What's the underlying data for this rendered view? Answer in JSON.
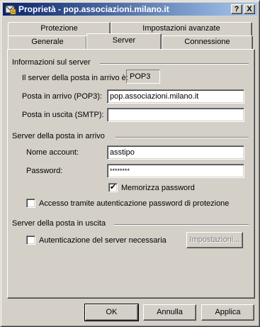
{
  "window": {
    "title": "Proprietà - pop.associazioni.milano.it",
    "help_glyph": "?",
    "close_glyph": "X"
  },
  "tabs": {
    "row_back": [
      "Protezione",
      "Impostazioni avanzate"
    ],
    "row_front": [
      "Generale",
      "Server",
      "Connessione"
    ],
    "active": "Server"
  },
  "server_info": {
    "heading": "Informazioni sul server",
    "incoming_type_label": "Il server della posta in arrivo è:",
    "incoming_type_value": "POP3",
    "incoming_label": "Posta in arrivo (POP3):",
    "incoming_value": "pop.associazioni.milano.it",
    "outgoing_label": "Posta in uscita (SMTP):",
    "outgoing_value": ""
  },
  "incoming_server": {
    "heading": "Server della posta in arrivo",
    "account_label": "Nome account:",
    "account_value": "asstipo",
    "password_label": "Password:",
    "password_value": "********",
    "remember_password_label": "Memorizza password",
    "remember_password_checked": true,
    "spa_label": "Accesso tramite autenticazione password di protezione",
    "spa_checked": false
  },
  "outgoing_server": {
    "heading": "Server della posta in uscita",
    "auth_label": "Autenticazione del server necessaria",
    "auth_checked": false,
    "settings_button": "Impostazioni..."
  },
  "buttons": {
    "ok": "OK",
    "cancel": "Annulla",
    "apply": "Applica"
  },
  "icons": {
    "title": "mail-properties-icon",
    "check": "✔"
  }
}
